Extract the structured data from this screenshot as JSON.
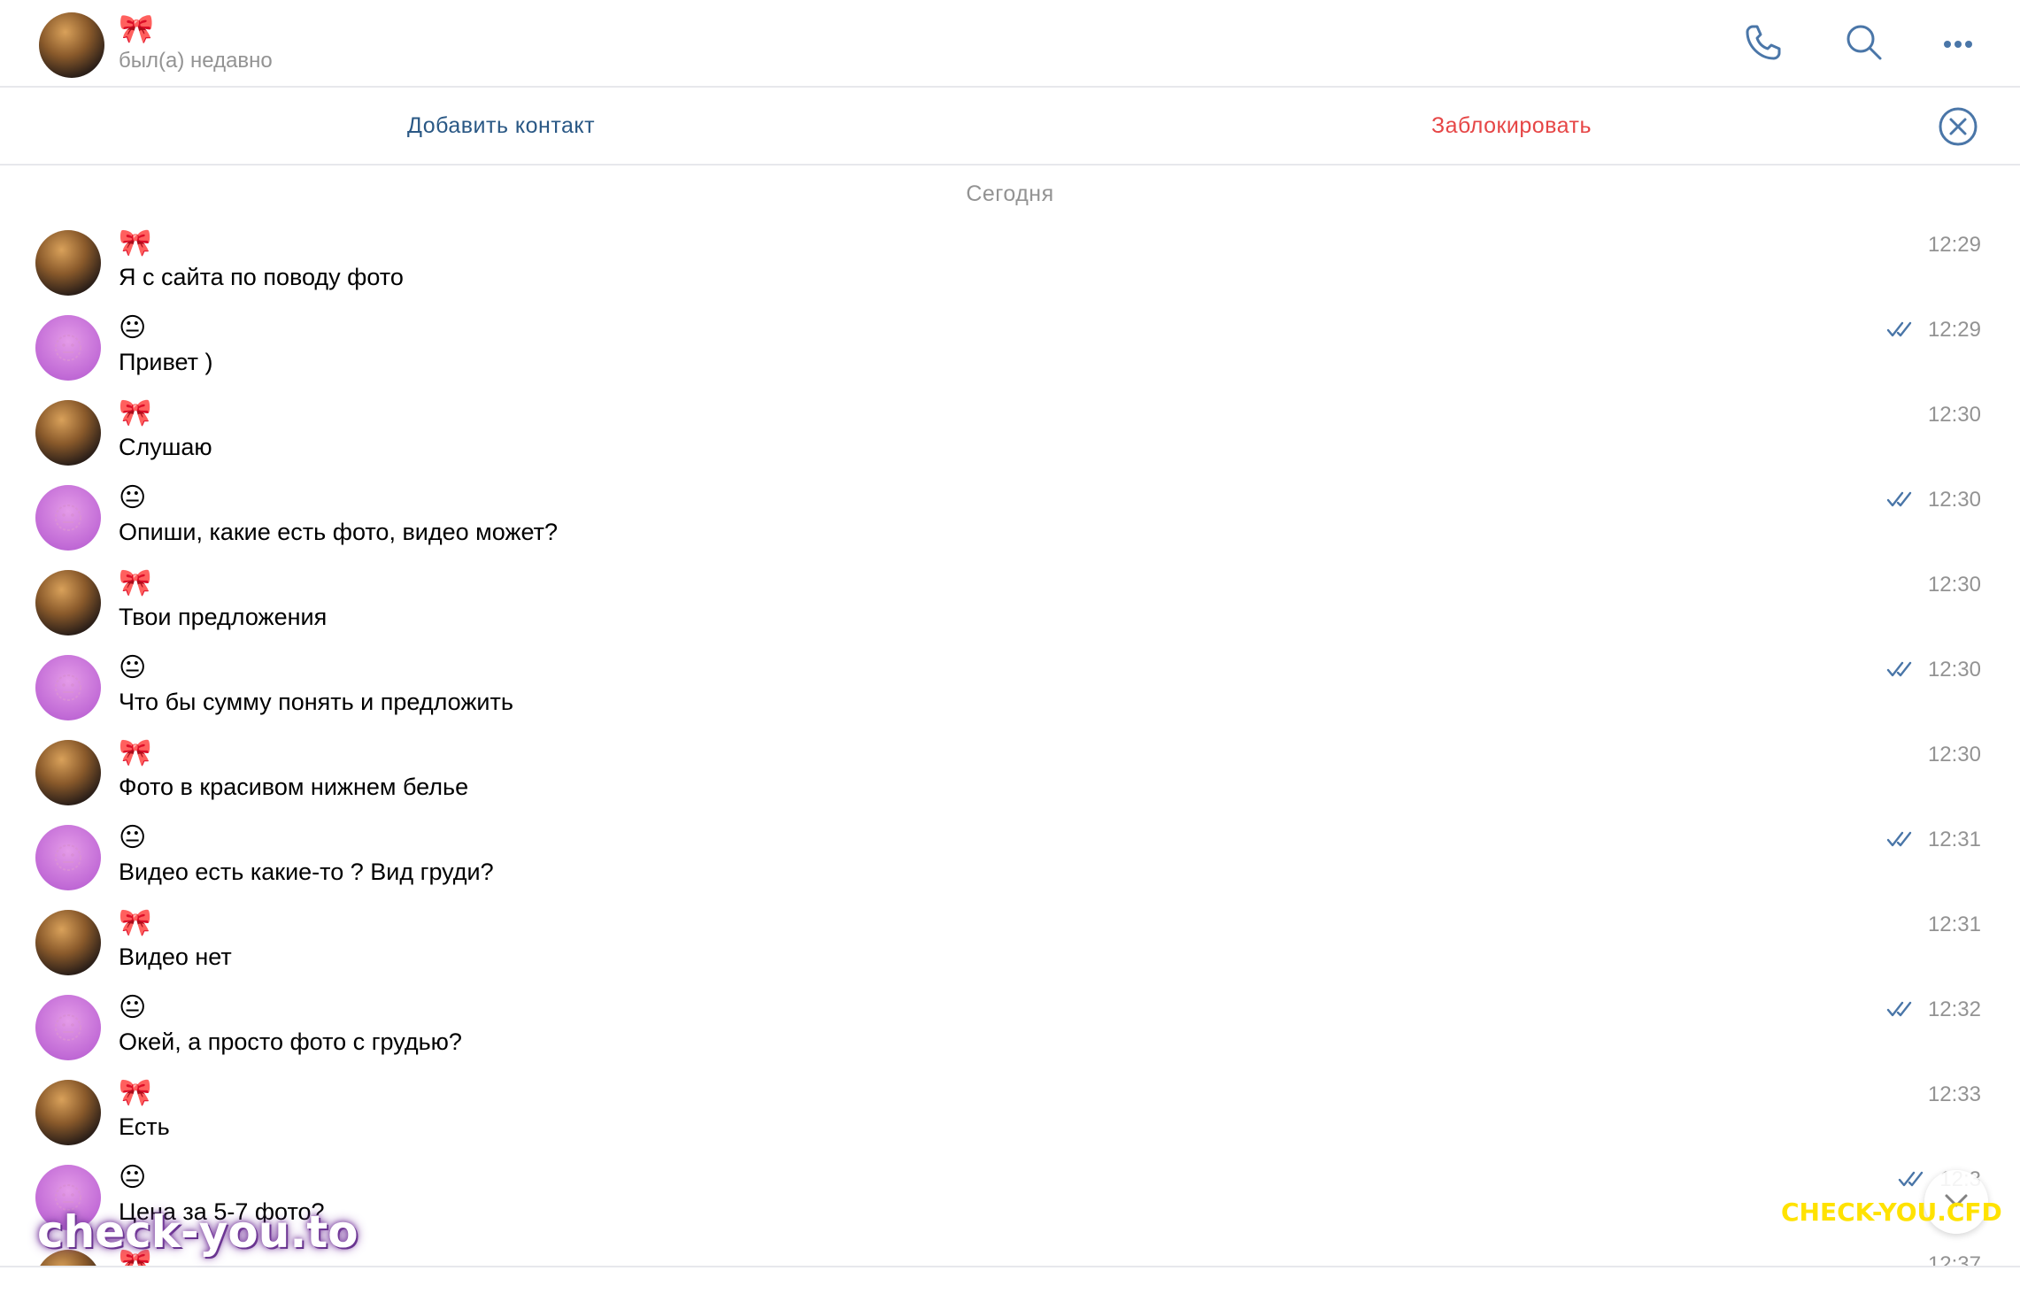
{
  "header": {
    "name": "🎀",
    "status": "был(а) недавно",
    "icons": [
      "phone-icon",
      "search-icon",
      "more-icon"
    ]
  },
  "action_bar": {
    "add_contact": "Добавить контакт",
    "block": "Заблокировать"
  },
  "date_divider": "Сегодня",
  "messages": [
    {
      "sender": "🎀",
      "text": "Я с сайта по поводу фото",
      "time": "12:29",
      "outgoing": false
    },
    {
      "sender": "😐",
      "text": "Привет )",
      "time": "12:29",
      "outgoing": true
    },
    {
      "sender": "🎀",
      "text": "Слушаю",
      "time": "12:30",
      "outgoing": false
    },
    {
      "sender": "😐",
      "text": "Опиши, какие есть фото, видео может?",
      "time": "12:30",
      "outgoing": true
    },
    {
      "sender": "🎀",
      "text": "Твои предложения",
      "time": "12:30",
      "outgoing": false
    },
    {
      "sender": "😐",
      "text": "Что бы сумму понять и предложить",
      "time": "12:30",
      "outgoing": true
    },
    {
      "sender": "🎀",
      "text": "Фото в красивом нижнем белье",
      "time": "12:30",
      "outgoing": false
    },
    {
      "sender": "😐",
      "text": "Видео есть какие-то ? Вид груди?",
      "time": "12:31",
      "outgoing": true
    },
    {
      "sender": "🎀",
      "text": "Видео нет",
      "time": "12:31",
      "outgoing": false
    },
    {
      "sender": "😐",
      "text": "Окей, а просто фото с грудью?",
      "time": "12:32",
      "outgoing": true
    },
    {
      "sender": "🎀",
      "text": "Есть",
      "time": "12:33",
      "outgoing": false
    },
    {
      "sender": "😐",
      "text": "Цена за 5-7 фото?",
      "time": "12:3",
      "outgoing": true
    },
    {
      "sender": "🎀",
      "text": "",
      "time": "12:37",
      "outgoing": false
    }
  ],
  "watermarks": {
    "left": "check-you.to",
    "right": "CHECK-YOU.CFD"
  },
  "colors": {
    "link": "#2a5885",
    "danger": "#e64646",
    "muted": "#939393",
    "accent": "#4a76a8",
    "divider": "#e7e8ec"
  }
}
